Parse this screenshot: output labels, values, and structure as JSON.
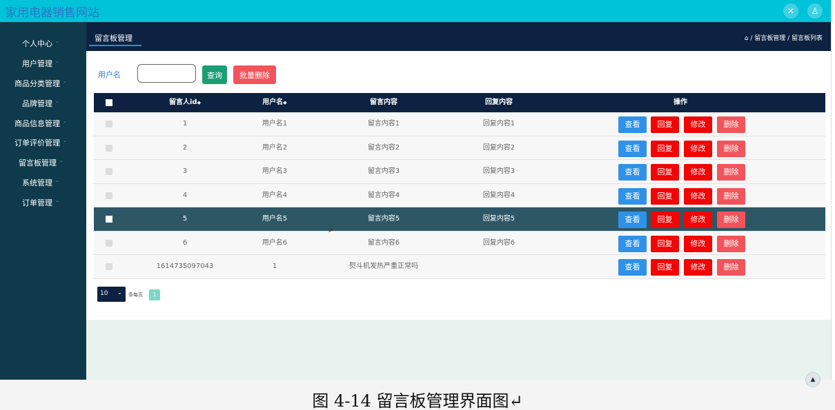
{
  "app": {
    "title": "家用电器销售网站"
  },
  "header_icons": [
    "fullscreen-icon",
    "user-icon"
  ],
  "sidebar": {
    "items": [
      {
        "label": "个人中心",
        "name": "sidebar-item-profile"
      },
      {
        "label": "用户管理",
        "name": "sidebar-item-users"
      },
      {
        "label": "商品分类管理",
        "name": "sidebar-item-categories"
      },
      {
        "label": "品牌管理",
        "name": "sidebar-item-brands"
      },
      {
        "label": "商品信息管理",
        "name": "sidebar-item-products"
      },
      {
        "label": "订单评价管理",
        "name": "sidebar-item-reviews"
      },
      {
        "label": "留言板管理",
        "name": "sidebar-item-messages"
      },
      {
        "label": "系统管理",
        "name": "sidebar-item-system"
      },
      {
        "label": "订单管理",
        "name": "sidebar-item-orders"
      }
    ]
  },
  "subheader": {
    "tab": "留言板管理",
    "breadcrumb": "/ 留言板管理 / 留言板列表"
  },
  "search": {
    "label": "用户名",
    "value": "",
    "query_button": "查询",
    "batch_delete_button": "批量删除"
  },
  "table": {
    "headers": {
      "id": "留言人id",
      "username": "用户名",
      "content": "留言内容",
      "reply": "回复内容",
      "actions": "操作"
    },
    "rows": [
      {
        "id": "1",
        "username": "用户名1",
        "content": "留言内容1",
        "reply": "回复内容1"
      },
      {
        "id": "2",
        "username": "用户名2",
        "content": "留言内容2",
        "reply": "回复内容2"
      },
      {
        "id": "3",
        "username": "用户名3",
        "content": "留言内容3",
        "reply": "回复内容3"
      },
      {
        "id": "4",
        "username": "用户名4",
        "content": "留言内容4",
        "reply": "回复内容4"
      },
      {
        "id": "5",
        "username": "用户名5",
        "content": "留言内容5",
        "reply": "回复内容5",
        "selected": true
      },
      {
        "id": "6",
        "username": "用户名6",
        "content": "留言内容6",
        "reply": "回复内容6"
      },
      {
        "id": "1614735097043",
        "username": "1",
        "content": "熨斗机发热严重正常吗",
        "reply": ""
      }
    ],
    "actions": {
      "view": "查看",
      "reply": "回复",
      "edit": "修改",
      "delete": "删除"
    }
  },
  "pagination": {
    "page_size": "10",
    "per_page_label": "条每页",
    "current_page": "1"
  },
  "caption": "图 4-14 留言板管理界面图↵"
}
